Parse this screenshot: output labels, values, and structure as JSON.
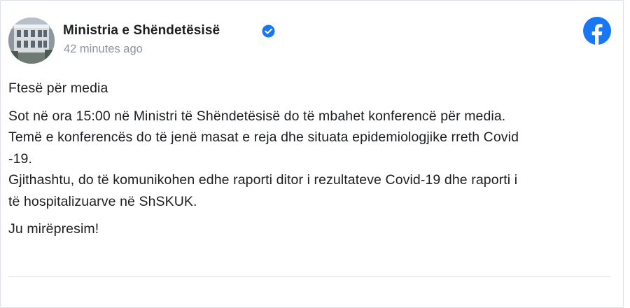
{
  "post": {
    "page_name": "Ministria e Shëndetësisë",
    "timestamp": "42 minutes ago",
    "verified": true,
    "avatar_icon": "building-photo-avatar",
    "platform_icon": "facebook-logo-icon",
    "brand_color": "#1877f2",
    "lines": [
      "Ftesë për media",
      "Sot në ora 15:00 në Ministri të Shëndetësisë do të mbahet konferencë për media.",
      "Temë e konferencës do të jenë masat e reja dhe situata epidemiologjike rreth Covid",
      "-19.",
      "Gjithashtu, do të komunikohen edhe raporti ditor i rezultateve Covid-19 dhe raporti i",
      "të hospitalizuarve në ShSKUK.",
      "Ju mirëpresim!"
    ]
  }
}
